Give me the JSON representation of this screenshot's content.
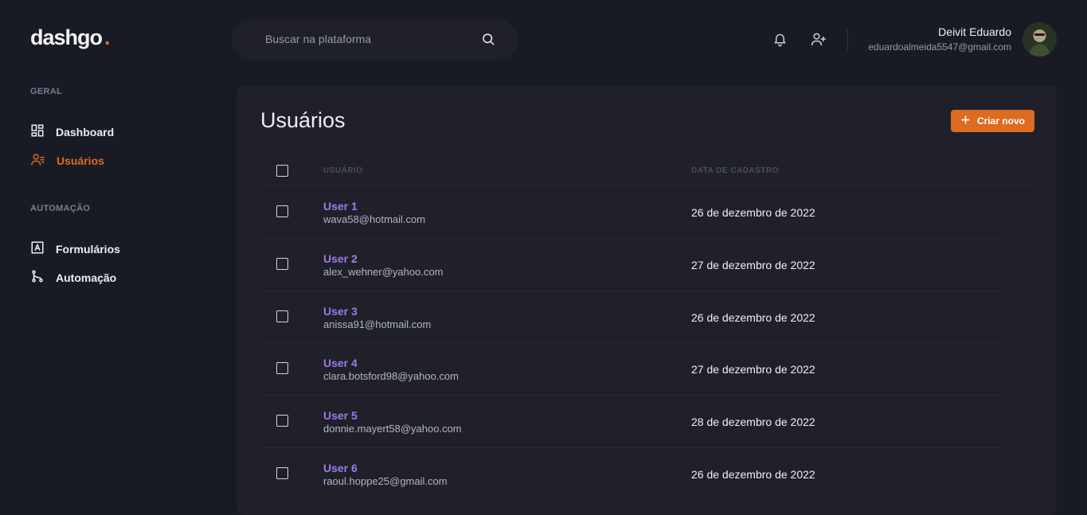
{
  "logo": {
    "text": "dashgo",
    "dot": "."
  },
  "search": {
    "placeholder": "Buscar na plataforma"
  },
  "profile": {
    "name": "Deivit Eduardo",
    "email": "eduardoalmeida5547@gmail.com"
  },
  "sidebar": {
    "sections": [
      {
        "title": "GERAL",
        "items": [
          {
            "label": "Dashboard",
            "icon": "dashboard-icon",
            "active": false
          },
          {
            "label": "Usuários",
            "icon": "users-icon",
            "active": true
          }
        ]
      },
      {
        "title": "AUTOMAÇÃO",
        "items": [
          {
            "label": "Formulários",
            "icon": "form-icon",
            "active": false
          },
          {
            "label": "Automação",
            "icon": "git-branch-icon",
            "active": false
          }
        ]
      }
    ]
  },
  "main": {
    "title": "Usuários",
    "create_label": "Criar novo",
    "columns": [
      "USUÁRIO",
      "DATA DE CADASTRO"
    ],
    "rows": [
      {
        "name": "User 1",
        "email": "wava58@hotmail.com",
        "date": "26 de dezembro de 2022"
      },
      {
        "name": "User 2",
        "email": "alex_wehner@yahoo.com",
        "date": "27 de dezembro de 2022"
      },
      {
        "name": "User 3",
        "email": "anissa91@hotmail.com",
        "date": "26 de dezembro de 2022"
      },
      {
        "name": "User 4",
        "email": "clara.botsford98@yahoo.com",
        "date": "27 de dezembro de 2022"
      },
      {
        "name": "User 5",
        "email": "donnie.mayert58@yahoo.com",
        "date": "28 de dezembro de 2022"
      },
      {
        "name": "User 6",
        "email": "raoul.hoppe25@gmail.com",
        "date": "26 de dezembro de 2022"
      }
    ]
  },
  "colors": {
    "accent": "#dd6b20",
    "user_name": "#9f7aea",
    "background": "#181b23",
    "panel": "#1f2029"
  }
}
